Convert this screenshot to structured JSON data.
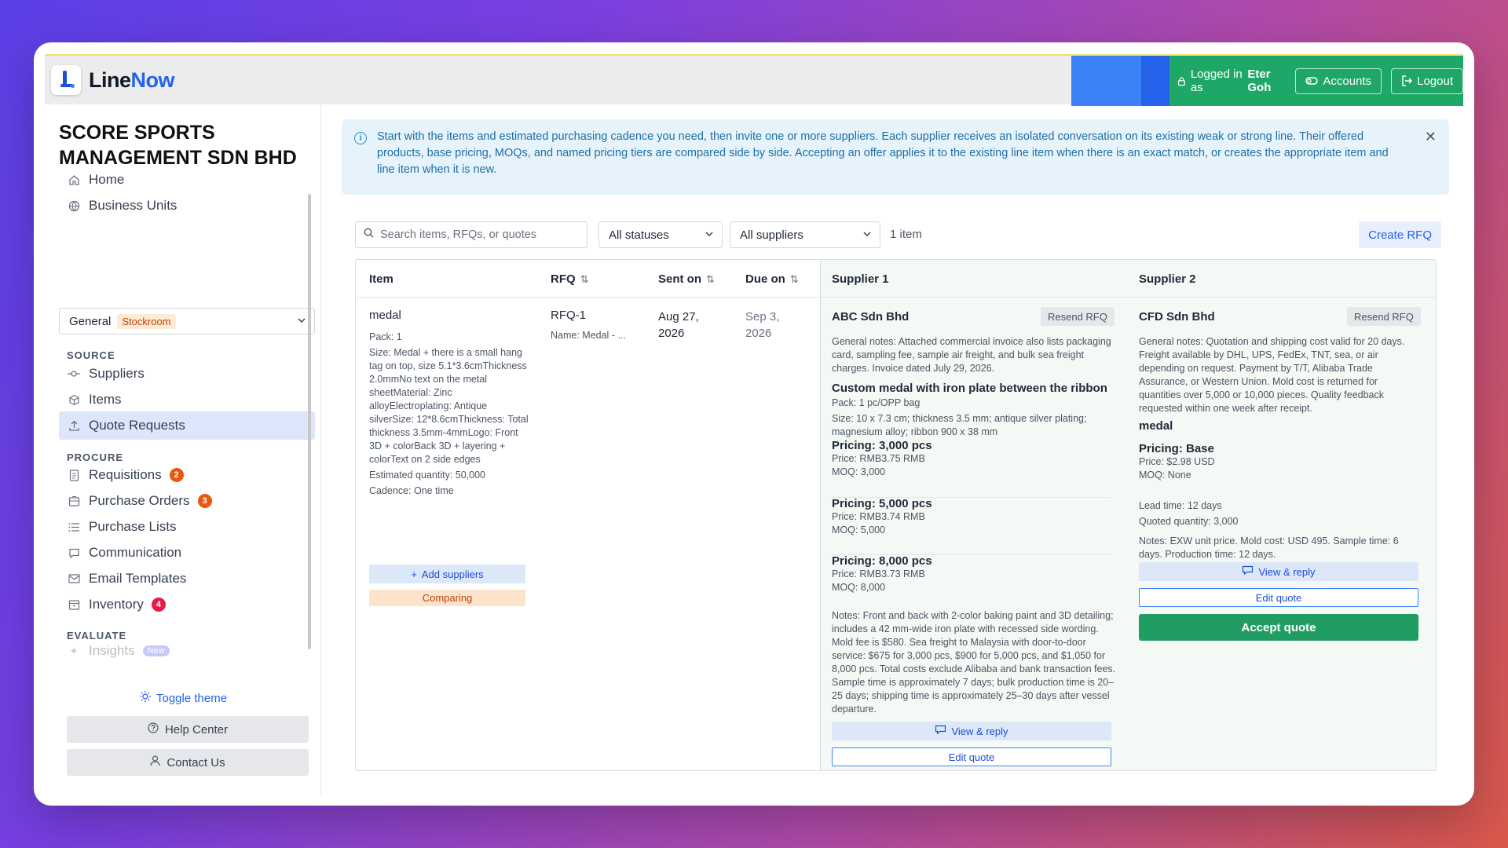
{
  "app": {
    "logo_part1": "Line",
    "logo_part2": "Now",
    "logged_in_prefix": "Logged in as",
    "user_name": "Eter Goh",
    "accounts_label": "Accounts",
    "logout_label": "Logout"
  },
  "sidebar": {
    "company": "SCORE SPORTS MANAGEMENT SDN BHD",
    "home": "Home",
    "business_units": "Business Units",
    "bu_selected": "General",
    "bu_tag": "Stockroom",
    "source_header": "SOURCE",
    "suppliers": "Suppliers",
    "items": "Items",
    "quote_requests": "Quote Requests",
    "procure_header": "PROCURE",
    "requisitions": "Requisitions",
    "requisitions_count": "2",
    "purchase_orders": "Purchase Orders",
    "purchase_orders_count": "3",
    "purchase_lists": "Purchase Lists",
    "communication": "Communication",
    "email_templates": "Email Templates",
    "inventory": "Inventory",
    "inventory_count": "4",
    "evaluate_header": "EVALUATE",
    "insights": "Insights",
    "insights_tag": "New",
    "toggle_theme": "Toggle theme",
    "help_center": "Help Center",
    "contact_us": "Contact Us"
  },
  "banner": {
    "text": "Start with the items and estimated purchasing cadence you need, then invite one or more suppliers. Each supplier receives an isolated conversation on its existing weak or strong line. Their offered products, base pricing, MOQs, and named pricing tiers are compared side by side. Accepting an offer applies it to the existing line item when there is an exact match, or creates the appropriate item and line item when it is new."
  },
  "toolbar": {
    "search_placeholder": "Search items, RFQs, or quotes",
    "status_filter": "All statuses",
    "supplier_filter": "All suppliers",
    "count": "1 item",
    "create_rfq": "Create RFQ"
  },
  "table": {
    "headers": {
      "item": "Item",
      "rfq": "RFQ",
      "sent_on": "Sent on",
      "due_on": "Due on",
      "supplier1": "Supplier 1",
      "supplier2": "Supplier 2"
    },
    "row": {
      "item_name": "medal",
      "pack": "Pack: 1",
      "size": "Size: Medal + there is a small hang tag on top, size 5.1*3.6cmThickness 2.0mmNo text on the metal sheetMaterial: Zinc alloyElectroplating: Antique silverSize: 12*8.6cmThickness: Total thickness 3.5mm-4mmLogo: Front 3D + colorBack 3D + layering + colorText on 2 side edges",
      "estimated_qty": "Estimated quantity: 50,000",
      "cadence": "Cadence: One time",
      "add_suppliers": "Add suppliers",
      "status": "Comparing",
      "rfq_id": "RFQ-1",
      "rfq_name": "Name: Medal - ...",
      "sent_on": "Aug 27, 2026",
      "due_on": "Sep 3, 2026"
    },
    "supplier1": {
      "name": "ABC Sdn Bhd",
      "resend": "Resend RFQ",
      "general_notes": "General notes: Attached commercial invoice also lists packaging card, sampling fee, sample air freight, and bulk sea freight charges. Invoice dated July 29, 2026.",
      "product_title": "Custom medal with iron plate between the ribbon",
      "pack": "Pack: 1 pc/OPP bag",
      "size": "Size: 10 x 7.3 cm; thickness 3.5 mm; antique silver plating; magnesium alloy; ribbon 900 x 38 mm",
      "tiers": [
        {
          "title": "Pricing: 3,000 pcs",
          "price": "Price: RMB3.75 RMB",
          "moq": "MOQ: 3,000"
        },
        {
          "title": "Pricing: 5,000 pcs",
          "price": "Price: RMB3.74 RMB",
          "moq": "MOQ: 5,000"
        },
        {
          "title": "Pricing: 8,000 pcs",
          "price": "Price: RMB3.73 RMB",
          "moq": "MOQ: 8,000"
        }
      ],
      "notes": "Notes: Front and back with 2-color baking paint and 3D detailing; includes a 42 mm-wide iron plate with recessed side wording. Mold fee is $580. Sea freight to Malaysia with door-to-door service: $675 for 3,000 pcs, $900 for 5,000 pcs, and $1,050 for 8,000 pcs. Total costs exclude Alibaba and bank transaction fees. Sample time is approximately 7 days; bulk production time is 20–25 days; shipping time is approximately 25–30 days after vessel departure.",
      "view_reply": "View & reply",
      "edit_quote": "Edit quote"
    },
    "supplier2": {
      "name": "CFD Sdn Bhd",
      "resend": "Resend RFQ",
      "general_notes": "General notes: Quotation and shipping cost valid for 20 days. Freight available by DHL, UPS, FedEx, TNT, sea, or air depending on request. Payment by T/T, Alibaba Trade Assurance, or Western Union. Mold cost is returned for quantities over 5,000 or 10,000 pieces. Quality feedback requested within one week after receipt.",
      "product_title": "medal",
      "pricing_title": "Pricing: Base",
      "price": "Price: $2.98 USD",
      "moq": "MOQ: None",
      "lead_time": "Lead time: 12 days",
      "quoted_qty": "Quoted quantity: 3,000",
      "notes": "Notes: EXW unit price. Mold cost: USD 495. Sample time: 6 days. Production time: 12 days.",
      "view_reply": "View & reply",
      "edit_quote": "Edit quote",
      "accept": "Accept quote"
    }
  },
  "colors": {
    "brand_blue": "#2563eb",
    "topbar_green": "#1fa767",
    "accept_green": "#1f9d63",
    "badge_orange": "#ea580c",
    "badge_red": "#e11d48"
  }
}
